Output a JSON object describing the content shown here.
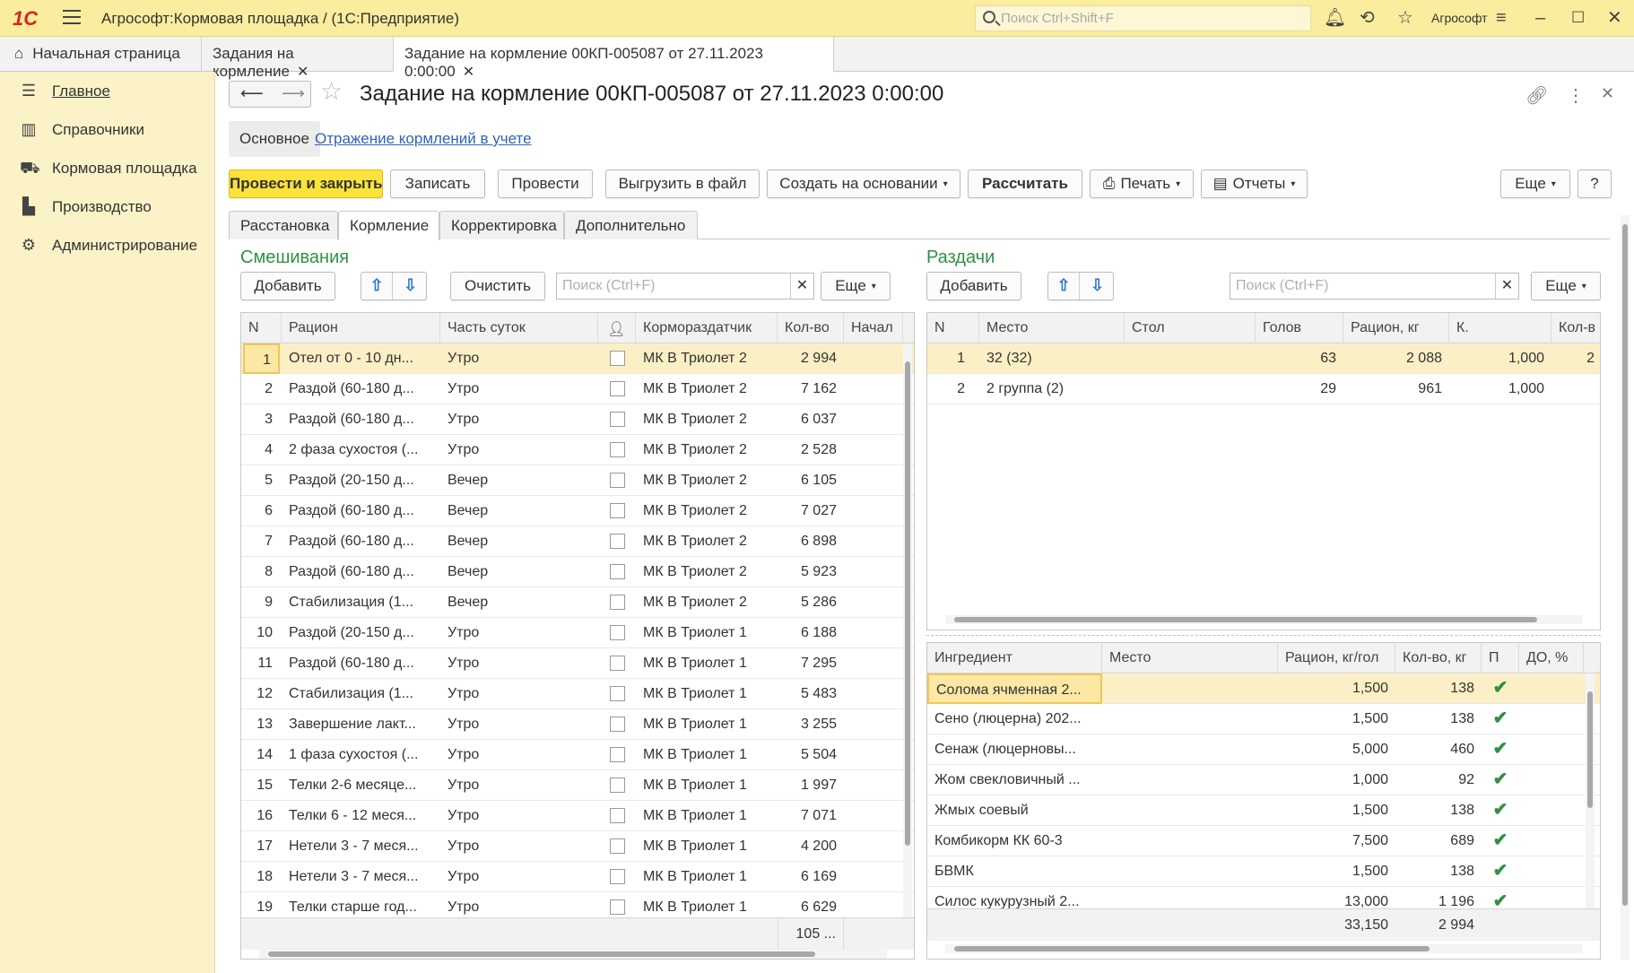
{
  "titlebar": {
    "logo": "1С",
    "app_title": "Агрософт:Кормовая площадка /  (1С:Предприятие)",
    "search_placeholder": "Поиск Ctrl+Shift+F",
    "user": "Агрософт",
    "icons": [
      "bell-icon",
      "history-icon",
      "star-icon",
      "settings-icon",
      "minimize-icon",
      "maximize-icon",
      "close-icon"
    ]
  },
  "tabs": [
    {
      "label": "Начальная страница"
    },
    {
      "label": "Задания на кормление"
    },
    {
      "label": "Задание на кормление 00КП-005087 от 27.11.2023 0:00:00"
    }
  ],
  "sidebar": {
    "items": [
      {
        "label": "Главное",
        "icon": "menu-icon"
      },
      {
        "label": "Справочники",
        "icon": "books-icon"
      },
      {
        "label": "Кормовая площадка",
        "icon": "tractor-icon"
      },
      {
        "label": "Производство",
        "icon": "factory-icon"
      },
      {
        "label": "Администрирование",
        "icon": "gear-icon"
      }
    ]
  },
  "doc": {
    "title": "Задание на кормление 00КП-005087 от 27.11.2023 0:00:00"
  },
  "subtabs": {
    "main": "Основное",
    "link": "Отражение кормлений в учете"
  },
  "toolbar": {
    "post_close": "Провести и закрыть",
    "save": "Записать",
    "post": "Провести",
    "export": "Выгрузить в файл",
    "create_based": "Создать на основании",
    "calculate": "Рассчитать",
    "print": "Печать",
    "reports": "Отчеты",
    "more": "Еще",
    "help": "?"
  },
  "formtabs": [
    "Расстановка",
    "Кормление",
    "Корректировка",
    "Дополнительно"
  ],
  "mix": {
    "title": "Смешивания",
    "add": "Добавить",
    "clear": "Очистить",
    "search_placeholder": "Поиск (Ctrl+F)",
    "more": "Еще",
    "columns": {
      "n": "N",
      "ration": "Рацион",
      "daypart": "Часть суток",
      "feeder": "Кормораздатчик",
      "qty": "Кол-во",
      "start": "Начал"
    },
    "rows": [
      {
        "n": "1",
        "ration": "Отел от 0 - 10 дн...",
        "daypart": "Утро",
        "feeder": "МК В Триолет 2",
        "qty": "2 994"
      },
      {
        "n": "2",
        "ration": "Раздой (60-180 д...",
        "daypart": "Утро",
        "feeder": "МК В Триолет 2",
        "qty": "7 162"
      },
      {
        "n": "3",
        "ration": "Раздой (60-180 д...",
        "daypart": "Утро",
        "feeder": "МК В Триолет 2",
        "qty": "6 037"
      },
      {
        "n": "4",
        "ration": "2 фаза сухостоя (...",
        "daypart": "Утро",
        "feeder": "МК В Триолет 2",
        "qty": "2 528"
      },
      {
        "n": "5",
        "ration": "Раздой (20-150 д...",
        "daypart": "Вечер",
        "feeder": "МК В Триолет 2",
        "qty": "6 105"
      },
      {
        "n": "6",
        "ration": "Раздой (60-180 д...",
        "daypart": "Вечер",
        "feeder": "МК В Триолет 2",
        "qty": "7 027"
      },
      {
        "n": "7",
        "ration": "Раздой (60-180 д...",
        "daypart": "Вечер",
        "feeder": "МК В Триолет 2",
        "qty": "6 898"
      },
      {
        "n": "8",
        "ration": "Раздой (60-180 д...",
        "daypart": "Вечер",
        "feeder": "МК В Триолет 2",
        "qty": "5 923"
      },
      {
        "n": "9",
        "ration": "Стабилизация (1...",
        "daypart": "Вечер",
        "feeder": "МК В Триолет 2",
        "qty": "5 286"
      },
      {
        "n": "10",
        "ration": "Раздой (20-150 д...",
        "daypart": "Утро",
        "feeder": "МК В Триолет 1",
        "qty": "6 188"
      },
      {
        "n": "11",
        "ration": "Раздой (60-180 д...",
        "daypart": "Утро",
        "feeder": "МК В Триолет 1",
        "qty": "7 295"
      },
      {
        "n": "12",
        "ration": "Стабилизация (1...",
        "daypart": "Утро",
        "feeder": "МК В Триолет 1",
        "qty": "5 483"
      },
      {
        "n": "13",
        "ration": "Завершение лакт...",
        "daypart": "Утро",
        "feeder": "МК В Триолет 1",
        "qty": "3 255"
      },
      {
        "n": "14",
        "ration": "1 фаза сухостоя (...",
        "daypart": "Утро",
        "feeder": "МК В Триолет 1",
        "qty": "5 504"
      },
      {
        "n": "15",
        "ration": "Телки 2-6 месяце...",
        "daypart": "Утро",
        "feeder": "МК В Триолет 1",
        "qty": "1 997"
      },
      {
        "n": "16",
        "ration": "Телки 6 - 12 меся...",
        "daypart": "Утро",
        "feeder": "МК В Триолет 1",
        "qty": "7 071"
      },
      {
        "n": "17",
        "ration": "Нетели 3 - 7 меся...",
        "daypart": "Утро",
        "feeder": "МК В Триолет 1",
        "qty": "4 200"
      },
      {
        "n": "18",
        "ration": "Нетели 3 - 7 меся...",
        "daypart": "Утро",
        "feeder": "МК В Триолет 1",
        "qty": "6 169"
      },
      {
        "n": "19",
        "ration": "Телки старше год...",
        "daypart": "Утро",
        "feeder": "МК В Триолет 1",
        "qty": "6 629"
      }
    ],
    "total_qty": "105 ..."
  },
  "dist": {
    "title": "Раздачи",
    "add": "Добавить",
    "search_placeholder": "Поиск (Ctrl+F)",
    "more": "Еще",
    "columns": {
      "n": "N",
      "place": "Место",
      "table": "Стол",
      "heads": "Голов",
      "ration": "Рацион, кг",
      "k": "К.",
      "qty": "Кол-в"
    },
    "rows": [
      {
        "n": "1",
        "place": "32 (32)",
        "table": "",
        "heads": "63",
        "ration": "2 088",
        "k": "1,000",
        "qty": "2"
      },
      {
        "n": "2",
        "place": "2 группа (2)",
        "table": "",
        "heads": "29",
        "ration": "961",
        "k": "1,000",
        "qty": ""
      }
    ]
  },
  "ingr": {
    "columns": {
      "name": "Ингредиент",
      "place": "Место",
      "ration": "Рацион, кг/гол",
      "qty": "Кол-во, кг",
      "p": "П",
      "do": "ДО, %"
    },
    "rows": [
      {
        "name": "Солома ячменная 2...",
        "place": "",
        "ration": "1,500",
        "qty": "138",
        "p": "✔"
      },
      {
        "name": "Сено (люцерна) 202...",
        "place": "",
        "ration": "1,500",
        "qty": "138",
        "p": "✔"
      },
      {
        "name": "Сенаж (люцерновы...",
        "place": "",
        "ration": "5,000",
        "qty": "460",
        "p": "✔"
      },
      {
        "name": "Жом свекловичный ...",
        "place": "",
        "ration": "1,000",
        "qty": "92",
        "p": "✔"
      },
      {
        "name": "Жмых соевый",
        "place": "",
        "ration": "1,500",
        "qty": "138",
        "p": "✔"
      },
      {
        "name": "Комбикорм КК 60-3",
        "place": "",
        "ration": "7,500",
        "qty": "689",
        "p": "✔"
      },
      {
        "name": "БВМК",
        "place": "",
        "ration": "1,500",
        "qty": "138",
        "p": "✔"
      },
      {
        "name": "Силос кукурузный 2...",
        "place": "",
        "ration": "13,000",
        "qty": "1 196",
        "p": "✔"
      }
    ],
    "total_ration": "33,150",
    "total_qty": "2 994"
  }
}
